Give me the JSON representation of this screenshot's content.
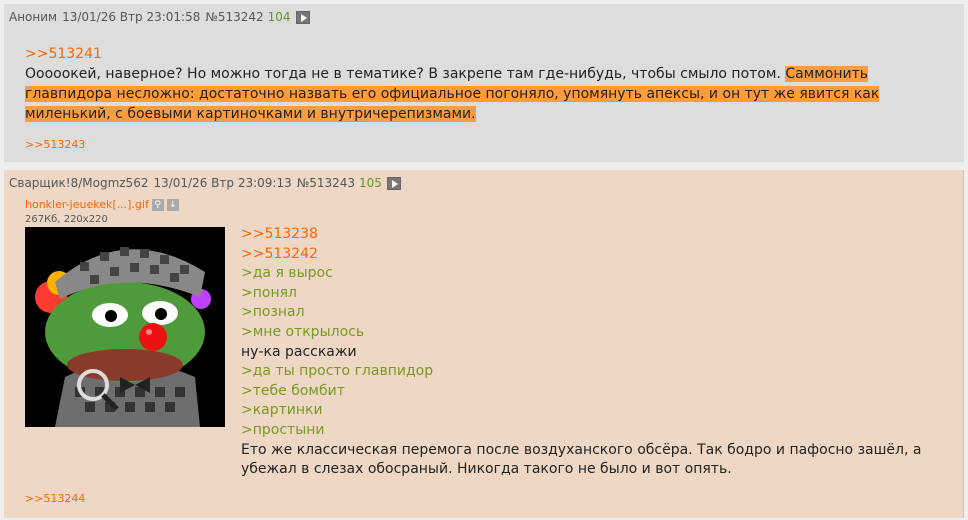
{
  "post1": {
    "author": "Аноним",
    "datetime": "13/01/26 Втр 23:01:58",
    "number": "№513242",
    "reply_count": "104",
    "reply_ref": ">>513241",
    "text_plain": "Ооооокей, наверное? Но можно тогда не в тематике? В закрепе там где-нибудь, чтобы смыло потом. ",
    "text_highlight": "Саммонить главпидора несложно: достаточно назвать его официальное погоняло, упомянуть апексы, и он тут же явится как миленький, с боевыми картиночками и внутричерепизмами.",
    "backlink": ">>513243"
  },
  "post2": {
    "author": "Сварщик!8/Mogmz562",
    "datetime": "13/01/26 Втр 23:09:13",
    "number": "№513243",
    "reply_count": "105",
    "file_name": "honkler-jeuekek[...].gif",
    "file_meta": "267Кб, 220x220",
    "lines": [
      {
        "text": ">>513238",
        "kind": "link"
      },
      {
        "text": ">>513242",
        "kind": "link"
      },
      {
        "text": ">да я вырос",
        "kind": "quote"
      },
      {
        "text": ">понял",
        "kind": "quote"
      },
      {
        "text": ">познал",
        "kind": "quote"
      },
      {
        "text": ">мне открылось",
        "kind": "quote"
      },
      {
        "text": "ну-ка расскажи",
        "kind": "plain"
      },
      {
        "text": ">да ты просто главпидор",
        "kind": "quote"
      },
      {
        "text": ">тебе бомбит",
        "kind": "quote"
      },
      {
        "text": ">картинки",
        "kind": "quote"
      },
      {
        "text": ">простыни",
        "kind": "quote"
      },
      {
        "text": "Ето же классическая перемога после воздуханского обсёра. Так бодро и пафосно зашёл, а убежал в слезах обосраный. Никогда такого не было и вот опять.",
        "kind": "plain"
      }
    ],
    "backlink": ">>513244"
  },
  "icons": {
    "play": "play-icon",
    "search": "search-icon",
    "download": "download-icon"
  }
}
